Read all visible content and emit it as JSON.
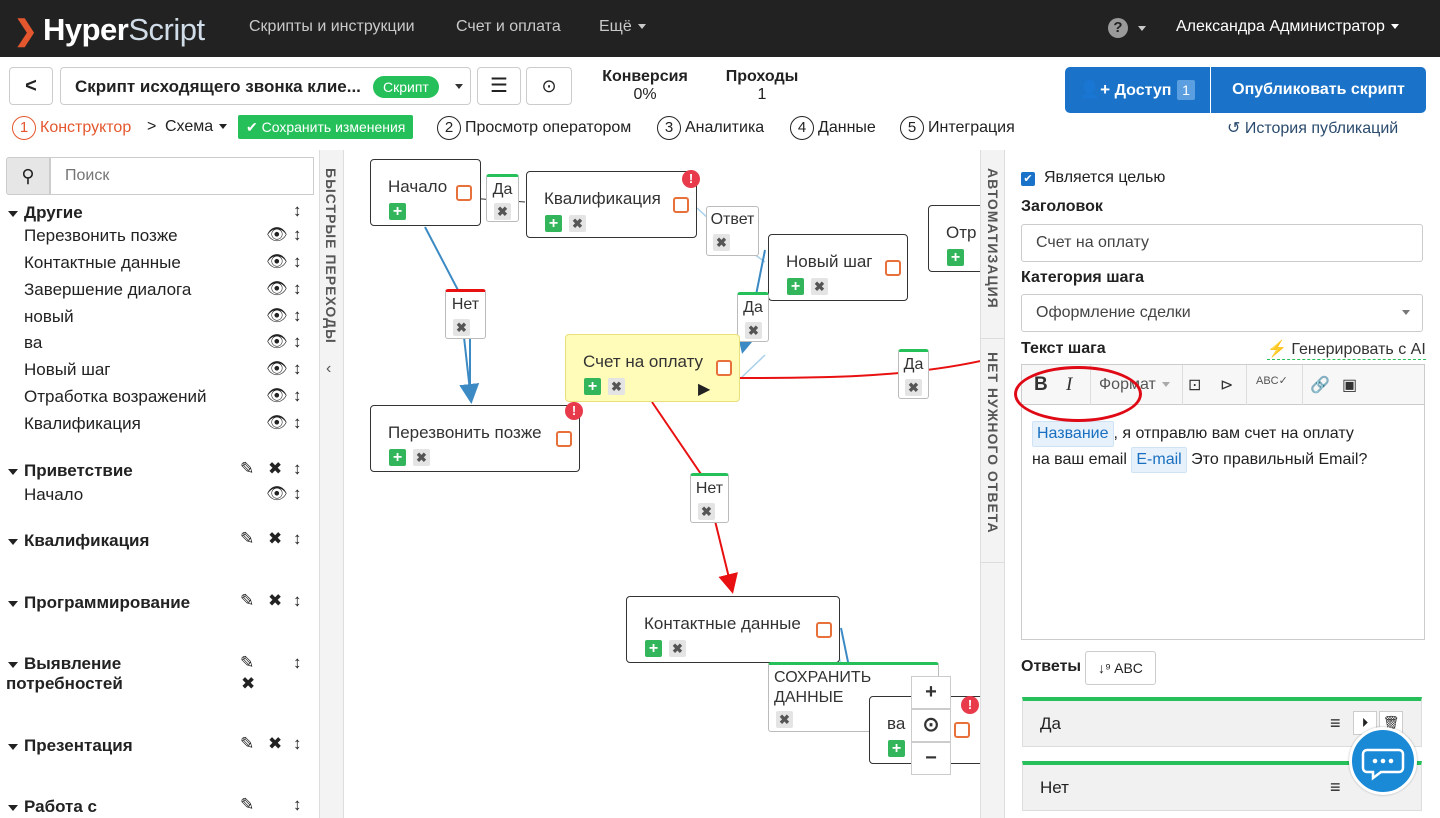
{
  "nav": {
    "logo_hyper": "Hyper",
    "logo_script": "Script",
    "links": [
      "Скрипты и инструкции",
      "Счет и оплата",
      "Ещё"
    ],
    "help": "?",
    "user": "Александра Администратор"
  },
  "toolbar": {
    "back": "<",
    "script_name": "Скрипт исходящего звонка клие...",
    "script_badge": "Скрипт",
    "conversion_label": "Конверсия",
    "conversion_value": "0%",
    "passes_label": "Проходы",
    "passes_value": "1",
    "access_label": "Доступ",
    "access_count": "1",
    "publish_label": "Опубликовать скрипт"
  },
  "steps": {
    "s1_num": "1",
    "s1": "Конструктор",
    "schema": "Схема",
    "save": "Сохранить изменения",
    "s2_num": "2",
    "s2": "Просмотр оператором",
    "s3_num": "3",
    "s3": "Аналитика",
    "s4_num": "4",
    "s4": "Данные",
    "s5_num": "5",
    "s5": "Интеграция",
    "history": "История публикаций"
  },
  "sidebar": {
    "search_placeholder": "Поиск",
    "quick_label": "БЫСТРЫЕ ПЕРЕХОДЫ",
    "g_other": "Другие",
    "other_items": [
      "Перезвонить позже",
      "Контактные данные",
      "Завершение диалога",
      "новый",
      "ва",
      "Новый шаг",
      "Отработка возражений",
      "Квалификация"
    ],
    "g_greet": "Приветствие",
    "greet_item": "Начало",
    "g_qual": "Квалификация",
    "g_prog": "Программирование",
    "g_needs_1": "Выявление",
    "g_needs_2": "потребностей",
    "g_pres": "Презентация",
    "g_work": "Работа с"
  },
  "canvas": {
    "nodes": {
      "start": "Начало",
      "qual": "Квалификация",
      "newstep": "Новый шаг",
      "otr": "Отр",
      "invoice": "Счет на оплату",
      "callback": "Перезвонить позже",
      "contacts": "Контактные данные",
      "va": "ва"
    },
    "edges": {
      "yes1": "Да",
      "answer": "Ответ",
      "no1": "Нет",
      "yes2": "Да",
      "yes3": "Да",
      "no2": "Нет",
      "save1": "СОХРАНИТЬ",
      "save2": "ДАННЫЕ"
    },
    "zoom": {
      "in": "+",
      "center": "⊙",
      "out": "−"
    }
  },
  "automation": {
    "label1": "АВТОМАТИЗАЦИЯ",
    "label2": "НЕТ НУЖНОГО ОТВЕТА"
  },
  "editor": {
    "is_goal": "Является целью",
    "title_label": "Заголовок",
    "title_value": "Счет на оплату",
    "category_label": "Категория шага",
    "category_value": "Оформление сделки",
    "text_label": "Текст шага",
    "ai_label": "Генерировать с AI",
    "fmt_bold": "B",
    "fmt_italic": "I",
    "fmt_format": "Формат",
    "text_tag1": "Название",
    "text_p1": ", я отправлю вам счет на оплату",
    "text_p2": "на ваш email",
    "text_tag2": "E-mail",
    "text_p3": "Это правильный Email?",
    "answers_label": "Ответы",
    "sort_label": "ABC",
    "answers": [
      "Да",
      "Нет"
    ]
  },
  "colors": {
    "brand_blue": "#1a73c9",
    "accent_orange": "#e4572e",
    "green": "#25c05a",
    "red_edge": "#e81010"
  }
}
